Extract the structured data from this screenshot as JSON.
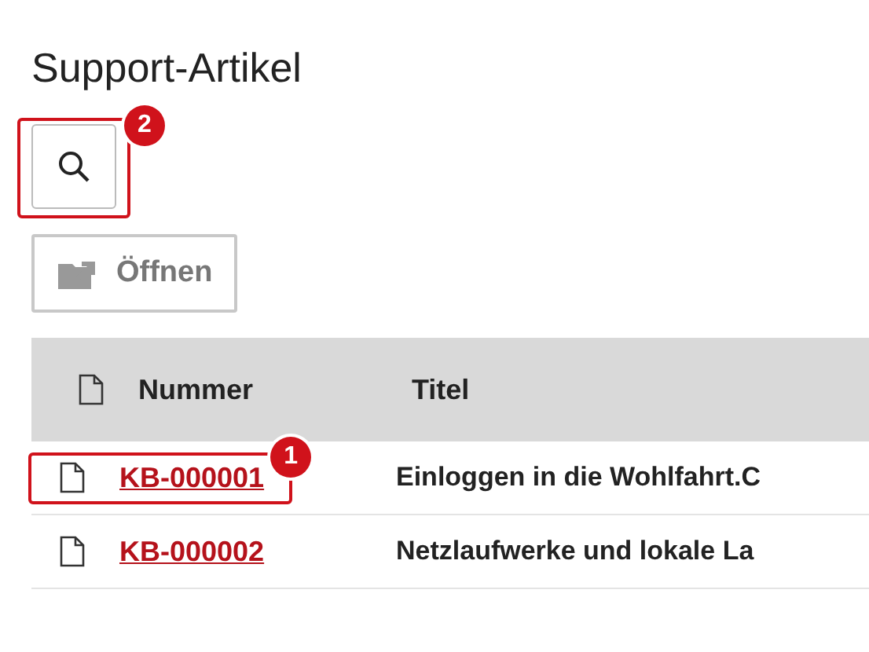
{
  "page": {
    "title": "Support-Artikel"
  },
  "search_button": {
    "callout": "2"
  },
  "toolbar": {
    "buttons": [
      {
        "label": "Öffnen",
        "disabled": true
      }
    ]
  },
  "table": {
    "columns": [
      "Nummer",
      "Titel"
    ],
    "rows": [
      {
        "number": "KB-000001",
        "title": "Einloggen in die Wohlfahrt.C",
        "callout": "1"
      },
      {
        "number": "KB-000002",
        "title": "Netzlaufwerke und lokale La"
      }
    ]
  }
}
